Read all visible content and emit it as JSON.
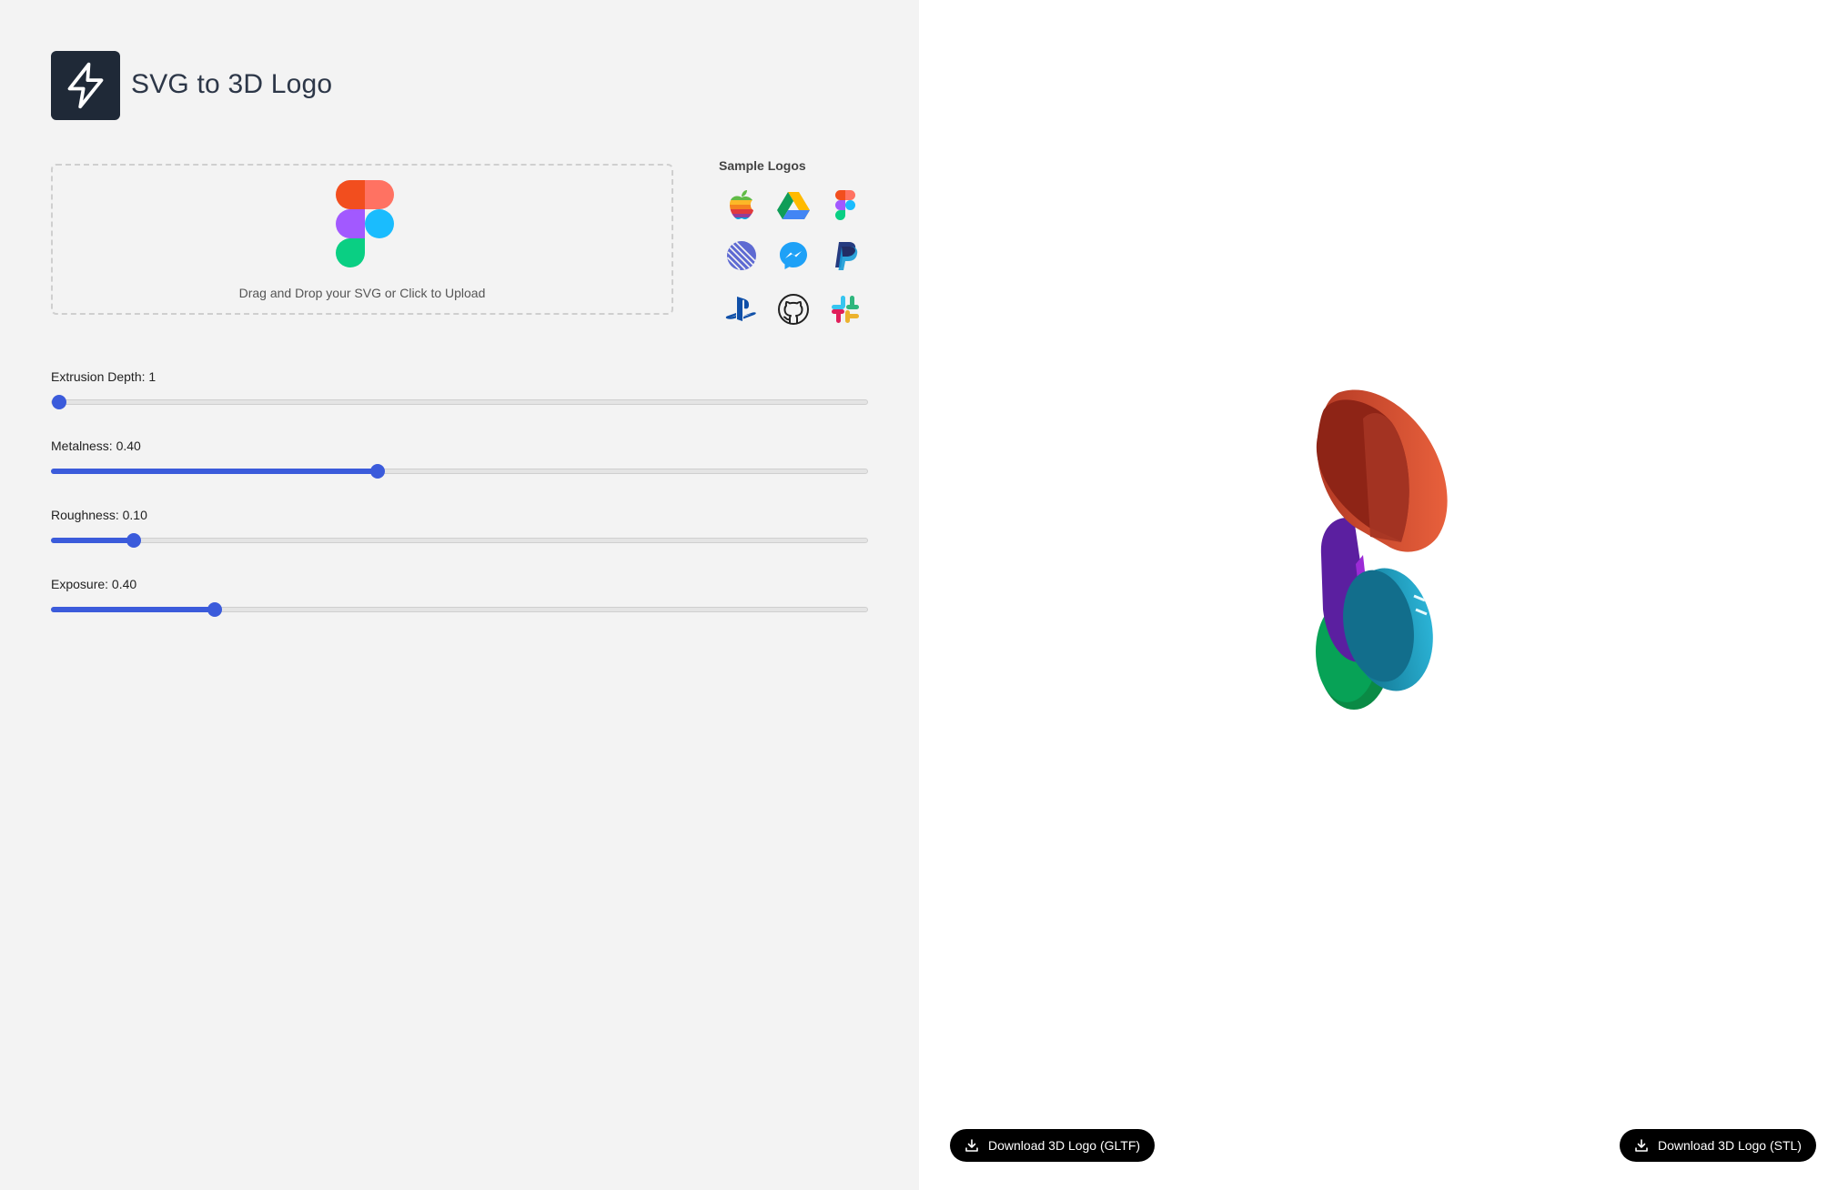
{
  "header": {
    "title": "SVG to 3D Logo",
    "icon": "lightning-icon"
  },
  "upload": {
    "hint": "Drag and Drop your SVG or Click to Upload",
    "preview_icon": "figma-logo-icon"
  },
  "samples": {
    "title": "Sample Logos",
    "items": [
      {
        "name": "apple-logo-icon"
      },
      {
        "name": "google-drive-logo-icon"
      },
      {
        "name": "figma-logo-icon"
      },
      {
        "name": "linear-logo-icon"
      },
      {
        "name": "messenger-logo-icon"
      },
      {
        "name": "paypal-logo-icon"
      },
      {
        "name": "playstation-logo-icon"
      },
      {
        "name": "github-logo-icon"
      },
      {
        "name": "slack-logo-icon"
      }
    ]
  },
  "sliders": [
    {
      "label": "Extrusion Depth: 1",
      "value_fraction": 0.0
    },
    {
      "label": "Metalness: 0.40",
      "value_fraction": 0.4
    },
    {
      "label": "Roughness: 0.10",
      "value_fraction": 0.1
    },
    {
      "label": "Exposure: 0.40",
      "value_fraction": 0.2
    }
  ],
  "downloads": {
    "gltf": "Download 3D Logo (GLTF)",
    "stl": "Download 3D Logo (STL)"
  },
  "colors": {
    "accent": "#3b5bdb",
    "panel": "#f3f3f3",
    "figma_red": "#f24e1e",
    "figma_orange": "#ff7262",
    "figma_purple": "#a259ff",
    "figma_blue": "#1abcfe",
    "figma_green": "#0acf83"
  }
}
